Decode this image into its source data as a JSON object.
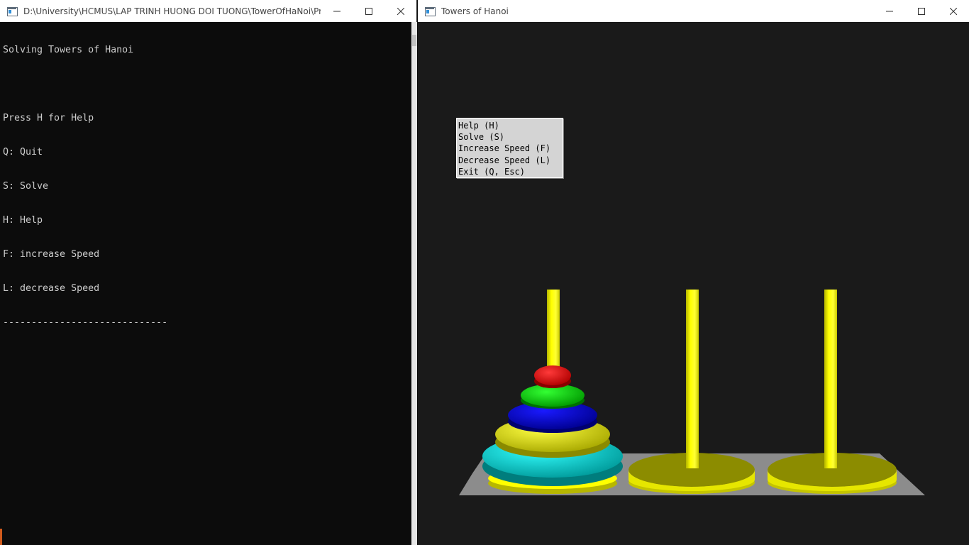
{
  "console_window": {
    "title": "D:\\University\\HCMUS\\LAP TRINH HUONG DOI TUONG\\TowerOfHaNoi\\Projec...",
    "lines": [
      "Solving Towers of Hanoi",
      "",
      "Press H for Help",
      "Q: Quit",
      "S: Solve",
      "H: Help",
      "F: increase Speed",
      "L: decrease Speed",
      "-----------------------------"
    ]
  },
  "gl_window": {
    "title": "Towers of Hanoi",
    "menu": [
      "Help (H)",
      "Solve (S)",
      "Increase Speed (F)",
      "Decrease Speed (L)",
      "Exit (Q, Esc)"
    ]
  },
  "scene": {
    "pegs": [
      {
        "name": "peg-1",
        "disks": [
          "cyan",
          "yellow",
          "blue",
          "green",
          "red"
        ]
      },
      {
        "name": "peg-2",
        "disks": []
      },
      {
        "name": "peg-3",
        "disks": []
      }
    ]
  },
  "colors": {
    "console_bg": "#0c0c0c",
    "console_text": "#cccccc",
    "gl_bg": "#1a1a1a",
    "peg": "#ffff00",
    "board": "#8c8c8c",
    "disk_red": "#ff0000",
    "disk_green": "#00e000",
    "disk_blue": "#0000e0",
    "disk_yellow": "#ffff00",
    "disk_cyan": "#00e6e6",
    "menu_bg": "#d4d4d4"
  },
  "icons": {
    "app": "console-window-icon",
    "minimize": "minimize-icon",
    "maximize": "maximize-icon",
    "close": "close-icon"
  }
}
